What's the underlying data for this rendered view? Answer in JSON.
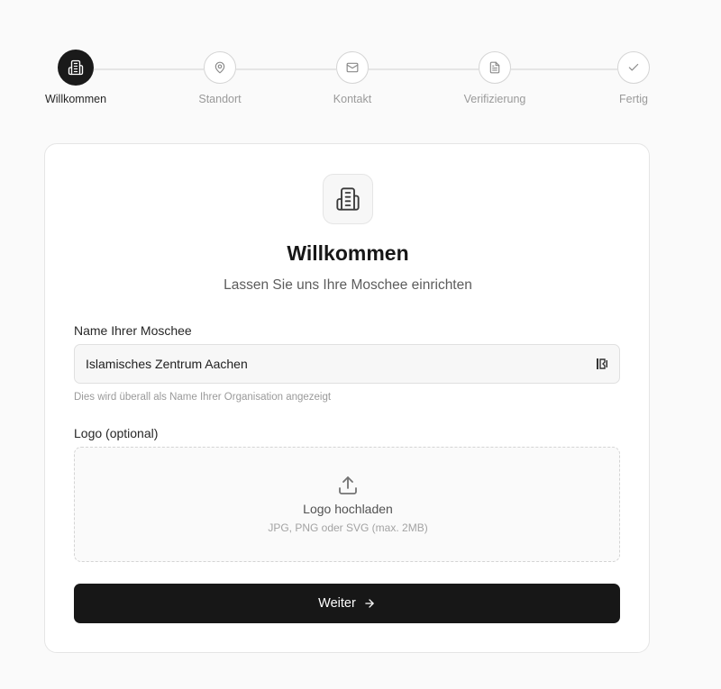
{
  "steps": [
    {
      "label": "Willkommen",
      "icon": "building-icon",
      "state": "active"
    },
    {
      "label": "Standort",
      "icon": "map-pin-icon",
      "state": "upcoming"
    },
    {
      "label": "Kontakt",
      "icon": "mail-icon",
      "state": "upcoming"
    },
    {
      "label": "Verifizierung",
      "icon": "document-icon",
      "state": "upcoming"
    },
    {
      "label": "Fertig",
      "icon": "check-icon",
      "state": "upcoming"
    }
  ],
  "card": {
    "icon": "building-icon",
    "title": "Willkommen",
    "subtitle": "Lassen Sie uns Ihre Moschee einrichten"
  },
  "name_field": {
    "label": "Name Ihrer Moschee",
    "value": "Islamisches Zentrum Aachen",
    "hint": "Dies wird überall als Name Ihrer Organisation angezeigt"
  },
  "logo_field": {
    "label": "Logo (optional)",
    "upload_icon": "upload-icon",
    "upload_title": "Logo hochladen",
    "upload_hint": "JPG, PNG oder SVG (max. 2MB)"
  },
  "next_button": {
    "label": "Weiter",
    "icon": "arrow-right-icon"
  },
  "colors": {
    "primary": "#171717",
    "background": "#fafafa",
    "border": "#e5e5e5",
    "muted_text": "#9a9a9a"
  }
}
